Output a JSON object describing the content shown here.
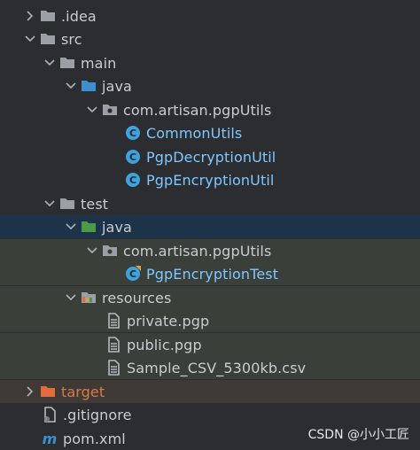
{
  "tree": {
    "items": [
      {
        "label": ".idea",
        "icon": "folder-icon",
        "expanded": false
      },
      {
        "label": "src",
        "icon": "folder-icon",
        "expanded": true
      },
      {
        "label": "main",
        "icon": "folder-icon",
        "expanded": true
      },
      {
        "label": "java",
        "icon": "source-folder-icon",
        "expanded": true
      },
      {
        "label": "com.artisan.pgpUtils",
        "icon": "package-icon",
        "expanded": true
      },
      {
        "label": "CommonUtils",
        "icon": "class-icon"
      },
      {
        "label": "PgpDecryptionUtil",
        "icon": "class-icon"
      },
      {
        "label": "PgpEncryptionUtil",
        "icon": "class-icon"
      },
      {
        "label": "test",
        "icon": "folder-icon",
        "expanded": true
      },
      {
        "label": "java",
        "icon": "test-source-folder-icon",
        "expanded": true,
        "selected": true
      },
      {
        "label": "com.artisan.pgpUtils",
        "icon": "package-icon",
        "expanded": true
      },
      {
        "label": "PgpEncryptionTest",
        "icon": "test-class-icon"
      },
      {
        "label": "resources",
        "icon": "test-resources-folder-icon",
        "expanded": true
      },
      {
        "label": "private.pgp",
        "icon": "file-icon"
      },
      {
        "label": "public.pgp",
        "icon": "file-icon"
      },
      {
        "label": "Sample_CSV_5300kb.csv",
        "icon": "file-icon"
      },
      {
        "label": "target",
        "icon": "excluded-folder-icon",
        "expanded": false
      },
      {
        "label": ".gitignore",
        "icon": "gitignore-icon"
      },
      {
        "label": "pom.xml",
        "icon": "maven-icon"
      }
    ]
  },
  "watermark": "CSDN @小小工匠",
  "colors": {
    "background": "#2b2d30",
    "selection": "#1d3349",
    "test_background": "#3b3f3a",
    "excluded_background": "#403a36",
    "class_text": "#7fc7ff",
    "excluded_text": "#d77a4a"
  }
}
